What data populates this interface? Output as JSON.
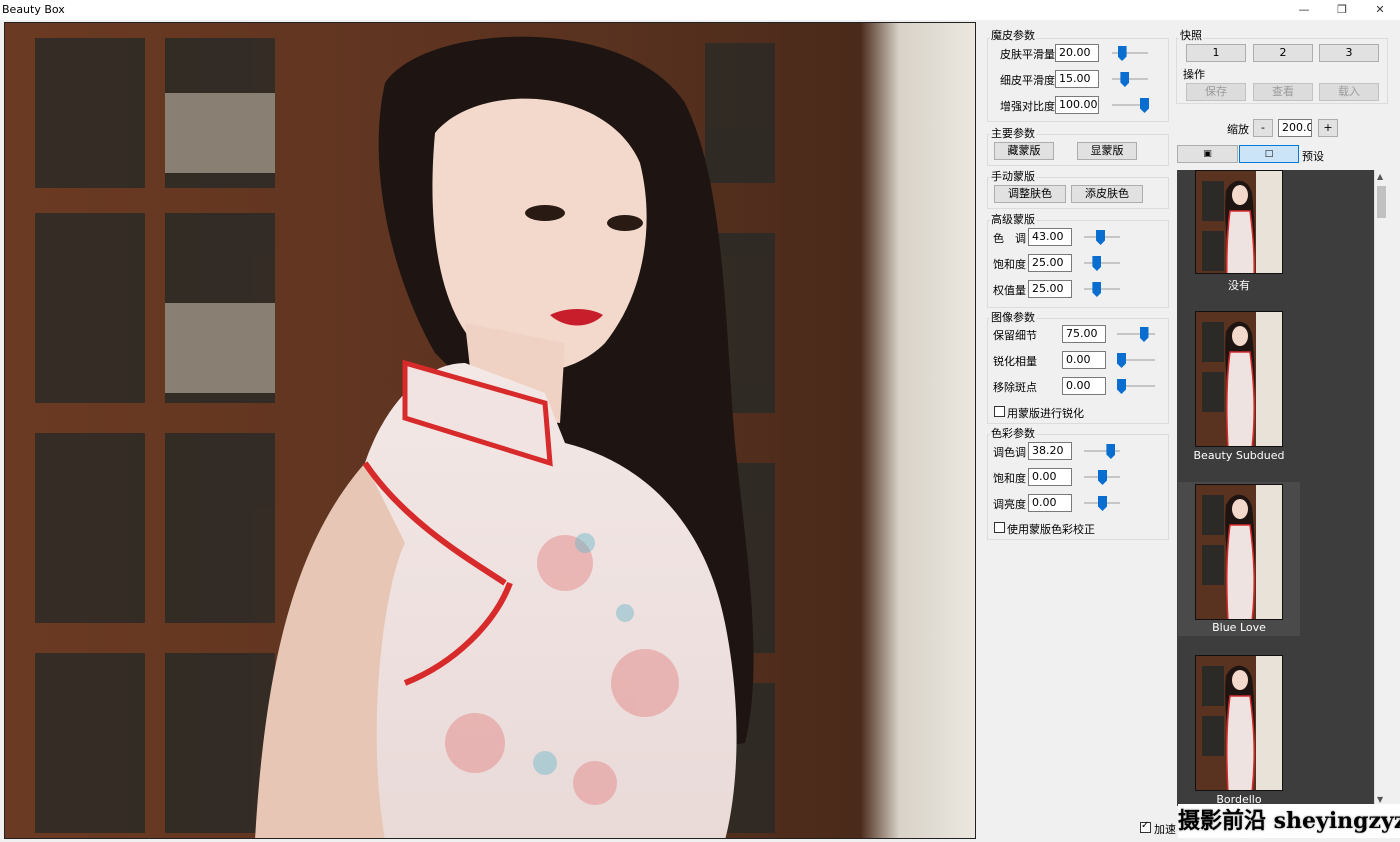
{
  "window": {
    "title": "Beauty Box",
    "minimize": "—",
    "restore": "❐",
    "close": "✕"
  },
  "skin_params": {
    "title": "魔皮参数",
    "rows": [
      {
        "label": "皮肤平滑量",
        "value": "20.00",
        "level": 0.2
      },
      {
        "label": "细皮平滑度",
        "value": "15.00",
        "level": 0.3
      },
      {
        "label": "增强对比度",
        "value": "100.00",
        "level": 1.0
      }
    ]
  },
  "main_params": {
    "title": "主要参数",
    "hide_mask": "藏蒙版",
    "show_mask": "显蒙版"
  },
  "manual_mask": {
    "title": "手动蒙版",
    "adjust_skin": "调整肤色",
    "add_skin": "添皮肤色"
  },
  "advanced_mask": {
    "title": "高级蒙版",
    "rows": [
      {
        "label": "色　调",
        "value": "43.00",
        "level": 0.43
      },
      {
        "label": "饱和度",
        "value": "25.00",
        "level": 0.3
      },
      {
        "label": "权值量",
        "value": "25.00",
        "level": 0.3
      }
    ]
  },
  "image_params": {
    "title": "图像参数",
    "rows": [
      {
        "label": "保留细节",
        "value": "75.00",
        "level": 0.75
      },
      {
        "label": "锐化相量",
        "value": "0.00",
        "level": 0.0
      },
      {
        "label": "移除斑点",
        "value": "0.00",
        "level": 0.0
      }
    ],
    "checkbox": "用蒙版进行锐化"
  },
  "color_params": {
    "title": "色彩参数",
    "rows": [
      {
        "label": "调色调",
        "value": "38.20",
        "level": 0.8
      },
      {
        "label": "饱和度",
        "value": "0.00",
        "level": 0.5
      },
      {
        "label": "调亮度",
        "value": "0.00",
        "level": 0.5
      }
    ],
    "checkbox": "使用蒙版色彩校正"
  },
  "snapshot": {
    "title": "快照",
    "buttons": [
      "1",
      "2",
      "3"
    ]
  },
  "operations": {
    "title": "操作",
    "save": "保存",
    "view": "查看",
    "load": "载入"
  },
  "zoom": {
    "label": "缩放",
    "minus": "-",
    "value": "200.00",
    "plus": "+"
  },
  "view_toggle": {
    "split": "▣",
    "single": "□",
    "preset_label": "预设"
  },
  "presets": [
    "没有",
    "Beauty Subdued",
    "Blue Love",
    "Bordello"
  ],
  "footer": {
    "accelerate": "加速"
  },
  "watermark": "摄影前沿 sheyingzyz.com",
  "colors": {
    "accent": "#0a6ed1",
    "preset_bg": "#3d3d3d",
    "panel_bg": "#f0f0f0"
  }
}
